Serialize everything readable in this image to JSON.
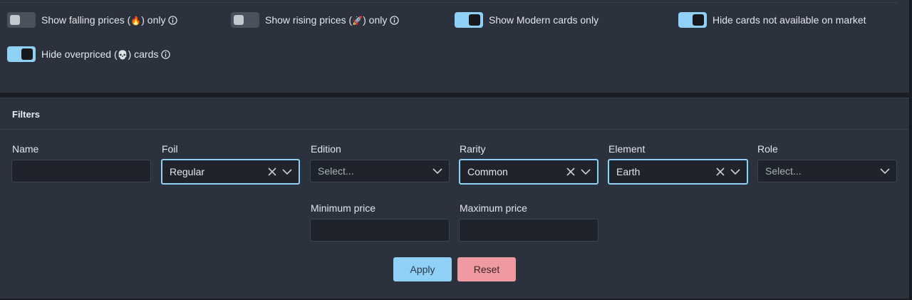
{
  "toggles": [
    {
      "label_pre": "Show falling prices (",
      "emoji": "🔥",
      "label_post": ") only",
      "on": false,
      "info": true
    },
    {
      "label_pre": "Show rising prices (",
      "emoji": "🚀",
      "label_post": ") only",
      "on": false,
      "info": true
    },
    {
      "label": "Show Modern cards only",
      "on": true,
      "info": false
    },
    {
      "label": "Hide cards not available on market",
      "on": true,
      "info": false
    },
    {
      "label_pre": "Hide overpriced (",
      "emoji": "💀",
      "label_post": ") cards",
      "on": true,
      "info": true
    }
  ],
  "filters": {
    "title": "Filters",
    "name_label": "Name",
    "name_value": "",
    "foil": {
      "label": "Foil",
      "value": "Regular"
    },
    "edition": {
      "label": "Edition",
      "placeholder": "Select..."
    },
    "rarity": {
      "label": "Rarity",
      "value": "Common"
    },
    "element": {
      "label": "Element",
      "value": "Earth"
    },
    "role": {
      "label": "Role",
      "placeholder": "Select..."
    },
    "min_price_label": "Minimum price",
    "min_price_value": "",
    "max_price_label": "Maximum price",
    "max_price_value": "",
    "apply_label": "Apply",
    "reset_label": "Reset"
  },
  "colors": {
    "accent": "#8ed0f6",
    "reset": "#ee9aa0",
    "panel": "#2b313d"
  }
}
